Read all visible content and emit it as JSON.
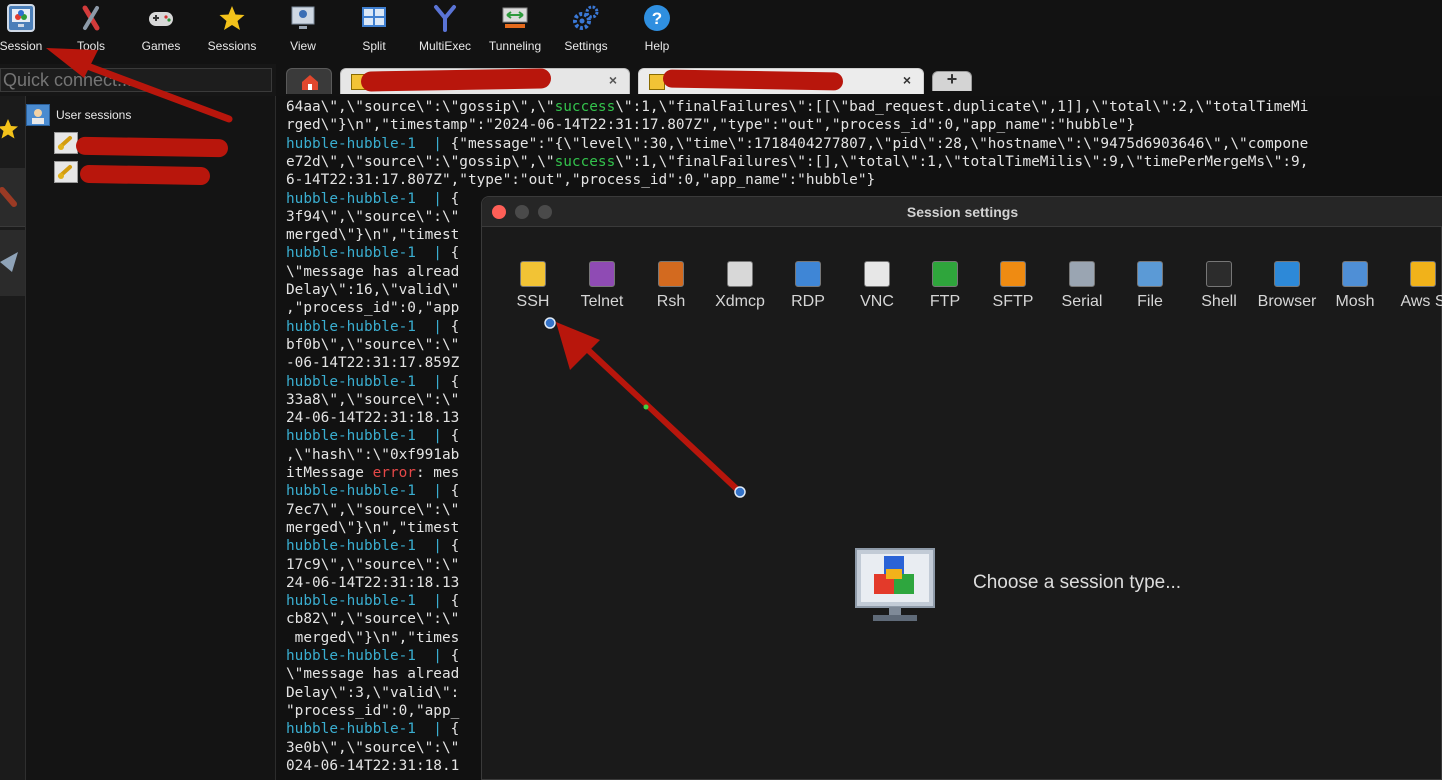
{
  "toolbar": {
    "items": [
      {
        "label": "Session",
        "icon": "session-icon"
      },
      {
        "label": "Tools",
        "icon": "tools-icon"
      },
      {
        "label": "Games",
        "icon": "gamepad-icon"
      },
      {
        "label": "Sessions",
        "icon": "star-icon"
      },
      {
        "label": "View",
        "icon": "view-icon"
      },
      {
        "label": "Split",
        "icon": "split-icon"
      },
      {
        "label": "MultiExec",
        "icon": "multiexec-icon"
      },
      {
        "label": "Tunneling",
        "icon": "tunneling-icon"
      },
      {
        "label": "Settings",
        "icon": "gears-icon"
      },
      {
        "label": "Help",
        "icon": "help-icon"
      }
    ]
  },
  "quick_connect": {
    "placeholder": "Quick connect..."
  },
  "sidebar": {
    "user_sessions_label": "User sessions"
  },
  "tabs": {
    "add_label": "+"
  },
  "terminal": {
    "lines": [
      "64aa\\\",\\\"source\\\":\\\"gossip\\\",\\\"success\\\":1,\\\"finalFailures\\\":[[\\\"bad_request.duplicate\\\",1]],\\\"total\\\":2,\\\"totalTimeMi",
      "rged\\\"}\\n\",\"timestamp\":\"2024-06-14T22:31:17.807Z\",\"type\":\"out\",\"process_id\":0,\"app_name\":\"hubble\"}",
      "hubble-hubble-1  | {\"message\":\"{\\\"level\\\":30,\\\"time\\\":1718404277807,\\\"pid\\\":28,\\\"hostname\\\":\\\"9475d6903646\\\",\\\"compone",
      "e72d\\\",\\\"source\\\":\\\"gossip\\\",\\\"success\\\":1,\\\"finalFailures\\\":[],\\\"total\\\":1,\\\"totalTimeMilis\\\":9,\\\"timePerMergeMs\\\":9,",
      "6-14T22:31:17.807Z\",\"type\":\"out\",\"process_id\":0,\"app_name\":\"hubble\"}",
      "hubble-hubble-1  | {",
      "3f94\\\",\\\"source\\\":\\\"",
      "merged\\\"}\\n\",\"timest",
      "hubble-hubble-1  | {",
      "\\\"message has alread",
      "Delay\\\":16,\\\"valid\\\"",
      ",\"process_id\":0,\"app",
      "hubble-hubble-1  | {",
      "bf0b\\\",\\\"source\\\":\\\"",
      "-06-14T22:31:17.859Z",
      "hubble-hubble-1  | {",
      "33a8\\\",\\\"source\\\":\\\"",
      "24-06-14T22:31:18.13",
      "hubble-hubble-1  | {",
      ",\\\"hash\\\":\\\"0xf991ab",
      "itMessage error: mes",
      "hubble-hubble-1  | {",
      "7ec7\\\",\\\"source\\\":\\\"",
      "merged\\\"}\\n\",\"timest",
      "hubble-hubble-1  | {",
      "17c9\\\",\\\"source\\\":\\\"",
      "24-06-14T22:31:18.13",
      "hubble-hubble-1  | {",
      "cb82\\\",\\\"source\\\":\\\"",
      " merged\\\"}\\n\",\"times",
      "hubble-hubble-1  | {",
      "\\\"message has alread",
      "Delay\\\":3,\\\"valid\\\":",
      "\"process_id\":0,\"app_",
      "hubble-hubble-1  | {",
      "3e0b\\\",\\\"source\\\":\\\"",
      "024-06-14T22:31:18.1"
    ]
  },
  "dialog": {
    "title": "Session settings",
    "session_types": [
      {
        "label": "SSH",
        "icon": "ssh-icon"
      },
      {
        "label": "Telnet",
        "icon": "telnet-icon"
      },
      {
        "label": "Rsh",
        "icon": "rsh-icon"
      },
      {
        "label": "Xdmcp",
        "icon": "xdmcp-icon"
      },
      {
        "label": "RDP",
        "icon": "rdp-icon"
      },
      {
        "label": "VNC",
        "icon": "vnc-icon"
      },
      {
        "label": "FTP",
        "icon": "ftp-icon"
      },
      {
        "label": "SFTP",
        "icon": "sftp-icon"
      },
      {
        "label": "Serial",
        "icon": "serial-icon"
      },
      {
        "label": "File",
        "icon": "file-icon"
      },
      {
        "label": "Shell",
        "icon": "shell-icon"
      },
      {
        "label": "Browser",
        "icon": "browser-icon"
      },
      {
        "label": "Mosh",
        "icon": "mosh-icon"
      },
      {
        "label": "Aws S",
        "icon": "aws-s3-icon"
      }
    ],
    "prompt": "Choose a session type..."
  },
  "colors": {
    "annotation_red": "#b8160c",
    "terminal_cyan": "#3aaed0",
    "terminal_green": "#33c24c",
    "terminal_red": "#e54848",
    "close_red": "#fe5f57"
  }
}
